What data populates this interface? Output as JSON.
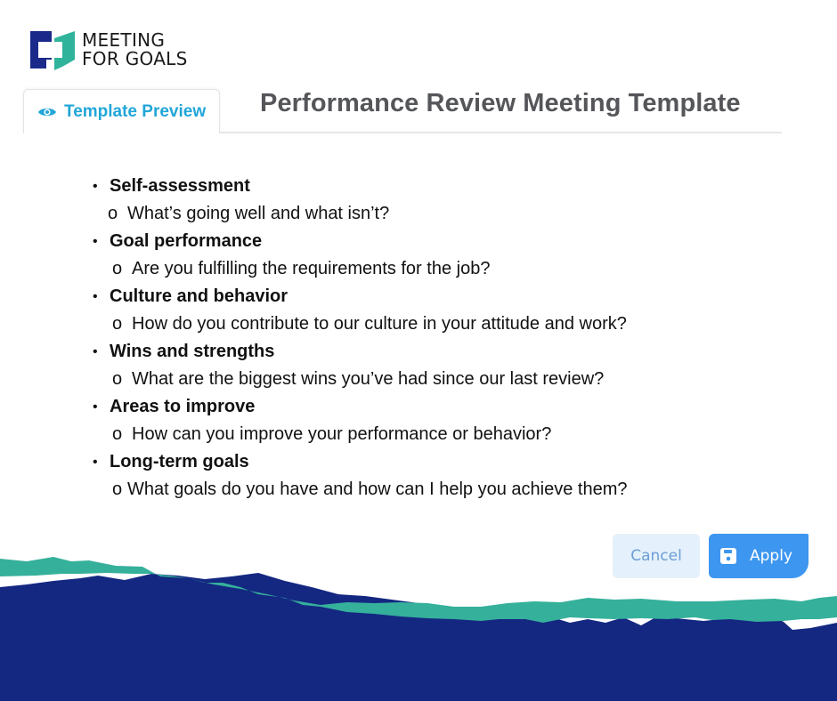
{
  "brand": {
    "line1": "MEETING",
    "line2": "FOR GOALS",
    "colors": {
      "navy": "#1b2a8a",
      "teal": "#2fb39b"
    }
  },
  "tab": {
    "icon": "eye-icon",
    "label": "Template Preview",
    "color": "#21a6d8"
  },
  "page": {
    "title": "Performance Review Meeting Template"
  },
  "agenda": [
    {
      "heading": "Self-assessment",
      "question": "What’s going well and what isn’t?"
    },
    {
      "heading": "Goal performance",
      "question": "Are you fulfilling the requirements for the job?"
    },
    {
      "heading": "Culture and behavior",
      "question": "How do you contribute to our culture in your attitude and work?"
    },
    {
      "heading": "Wins and strengths",
      "question": "What are the biggest wins you’ve had since our last review?"
    },
    {
      "heading": "Areas to improve",
      "question": "How can you improve your performance or behavior?"
    },
    {
      "heading": "Long-term goals",
      "question": "What goals do you have and how can I help you achieve them?"
    }
  ],
  "markers": {
    "bullet": "•",
    "sub": "o"
  },
  "actions": {
    "cancel_label": "Cancel",
    "apply_label": "Apply",
    "apply_icon": "save-icon"
  },
  "decoration": {
    "band_colors": {
      "teal": "#35b09b",
      "navy": "#142882"
    }
  }
}
